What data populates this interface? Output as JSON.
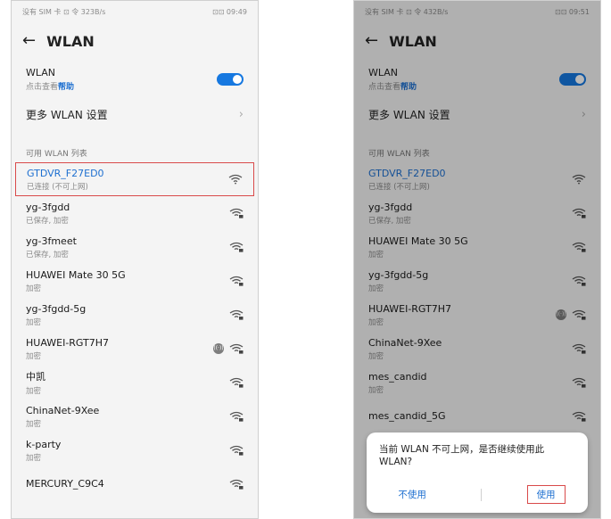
{
  "left": {
    "status_carrier": "没有 SIM 卡 ⊡ 令 323B/s",
    "status_right": "⊡⊡ 09:49",
    "title": "WLAN",
    "wlan_label": "WLAN",
    "wlan_sub": "点击查看",
    "wlan_help": "帮助",
    "more_label": "更多 WLAN 设置",
    "section_title": "可用 WLAN 列表",
    "networks": [
      {
        "name": "GTDVR_F27ED0",
        "status": "已连接 (不可上网)"
      },
      {
        "name": "yg-3fgdd",
        "status": "已保存, 加密"
      },
      {
        "name": "yg-3fmeet",
        "status": "已保存, 加密"
      },
      {
        "name": "HUAWEI Mate 30 5G",
        "status": "加密"
      },
      {
        "name": "yg-3fgdd-5g",
        "status": "加密"
      },
      {
        "name": "HUAWEI-RGT7H7",
        "status": "加密"
      },
      {
        "name": "中凯",
        "status": "加密"
      },
      {
        "name": "ChinaNet-9Xee",
        "status": "加密"
      },
      {
        "name": "k-party",
        "status": "加密"
      },
      {
        "name": "MERCURY_C9C4",
        "status": ""
      }
    ]
  },
  "right": {
    "status_carrier": "没有 SIM 卡 ⊡ 令 432B/s",
    "status_right": "⊡⊡ 09:51",
    "title": "WLAN",
    "wlan_label": "WLAN",
    "wlan_sub": "点击查看",
    "wlan_help": "帮助",
    "more_label": "更多 WLAN 设置",
    "section_title": "可用 WLAN 列表",
    "networks": [
      {
        "name": "GTDVR_F27ED0",
        "status": "已连接 (不可上网)"
      },
      {
        "name": "yg-3fgdd",
        "status": "已保存, 加密"
      },
      {
        "name": "HUAWEI Mate 30 5G",
        "status": "加密"
      },
      {
        "name": "yg-3fgdd-5g",
        "status": "加密"
      },
      {
        "name": "HUAWEI-RGT7H7",
        "status": "加密"
      },
      {
        "name": "ChinaNet-9Xee",
        "status": "加密"
      },
      {
        "name": "mes_candid",
        "status": "加密"
      },
      {
        "name": "mes_candid_5G",
        "status": ""
      }
    ],
    "dialog": {
      "message": "当前 WLAN 不可上网，是否继续使用此 WLAN?",
      "cancel": "不使用",
      "use": "使用"
    }
  },
  "colors": {
    "accent": "#1678e0",
    "highlight": "#d94a4a"
  }
}
